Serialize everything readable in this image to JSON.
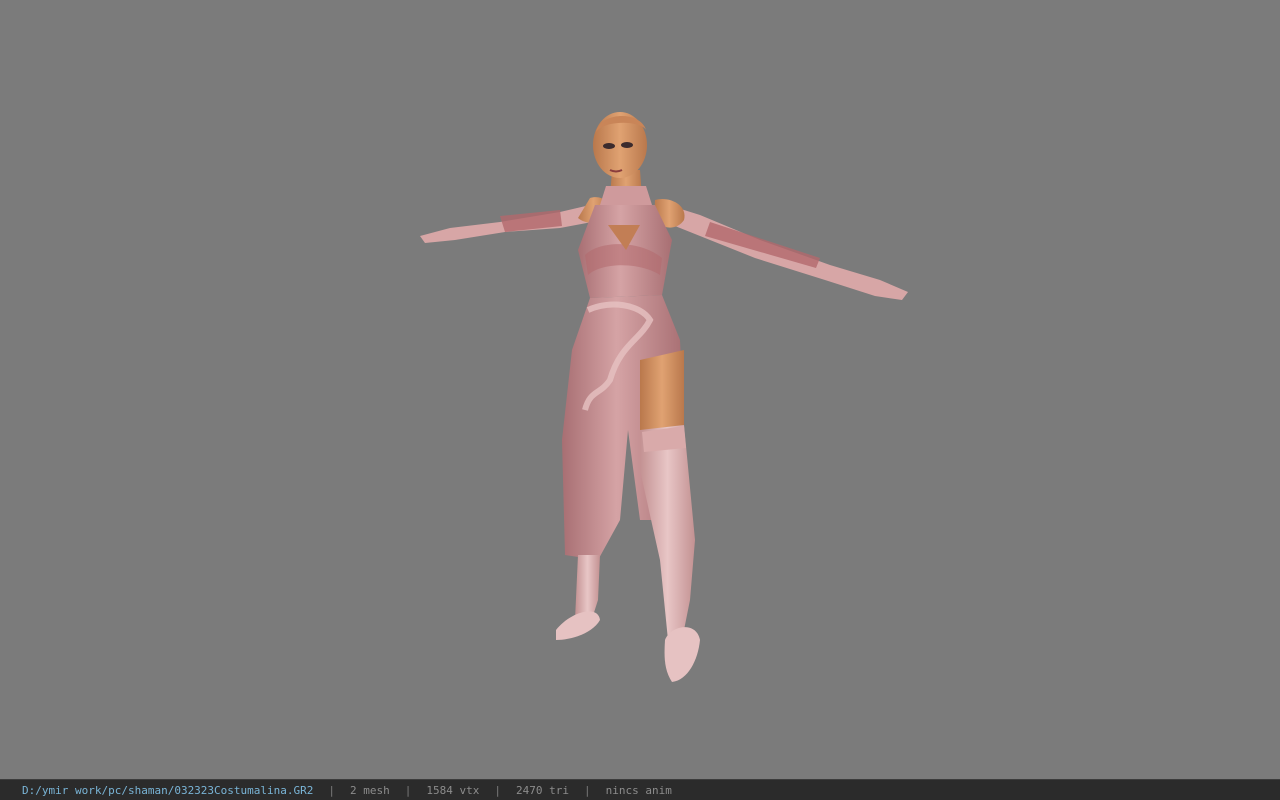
{
  "viewer": {
    "model": {
      "subject": "female character model in pink cheongsam-style dress, gloves and thigh-high stockings, T-pose",
      "colors": {
        "background": "#7b7b7b",
        "skin": "#d99a6a",
        "dress": "#cf9a9c",
        "dress_shadow": "#a56c70",
        "lace": "#b3696d"
      }
    }
  },
  "status_bar": {
    "file_path": "D:/ymir work/pc/shaman/032323Costumalina.GR2",
    "separator": "|",
    "mesh_count": "2 mesh",
    "vertex_count": "1584 vtx",
    "triangle_count": "2470 tri",
    "animation": "nincs anim",
    "colors": {
      "background": "#2b2b2b",
      "path_text": "#79b4d6",
      "info_text": "#8c8c8c"
    }
  }
}
